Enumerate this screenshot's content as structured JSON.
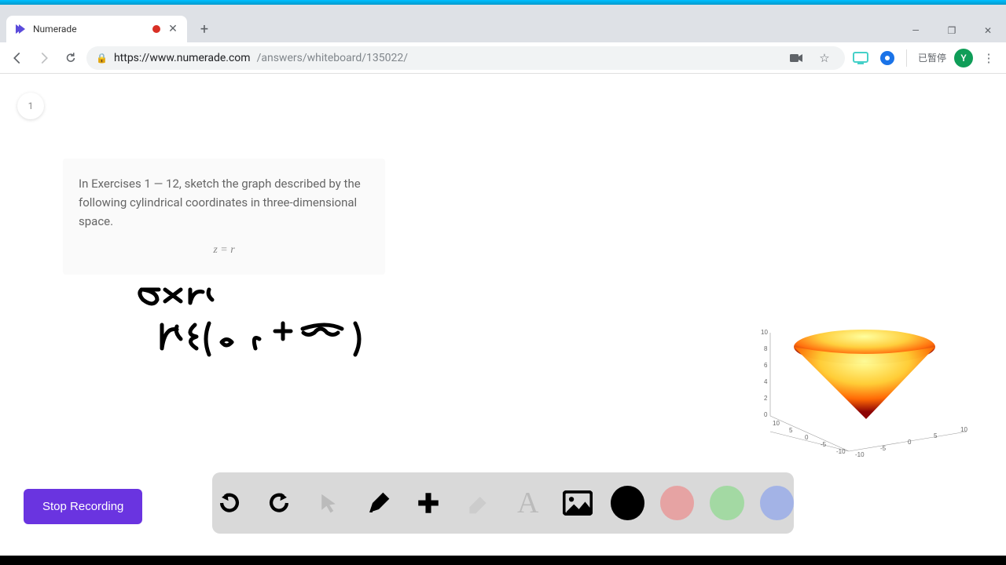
{
  "tab": {
    "title": "Numerade"
  },
  "url": {
    "host": "https://www.numerade.com",
    "path": "/answers/whiteboard/135022/"
  },
  "profile": {
    "status": "已暂停",
    "initial": "Y"
  },
  "page_number": "1",
  "question": {
    "text": "In Exercises 1 — 12, sketch the graph described by the following cylindrical coordinates in three-dimensional space.",
    "equation": "z = r"
  },
  "handwriting": {
    "line1": "z = r",
    "line2": "r ∈ (0 , +∞)"
  },
  "stop_label": "Stop Recording",
  "chart_data": {
    "type": "surface",
    "title": "",
    "description": "Upward-opening cone z = r in cylindrical coordinates",
    "z_ticks": [
      0,
      2,
      4,
      6,
      8,
      10
    ],
    "x_range": [
      -10,
      10
    ],
    "y_range": [
      -10,
      10
    ],
    "axis_ticks": [
      -10,
      -5,
      0,
      5,
      10
    ],
    "colormap": "hot (dark red at apex to yellow at rim)"
  }
}
